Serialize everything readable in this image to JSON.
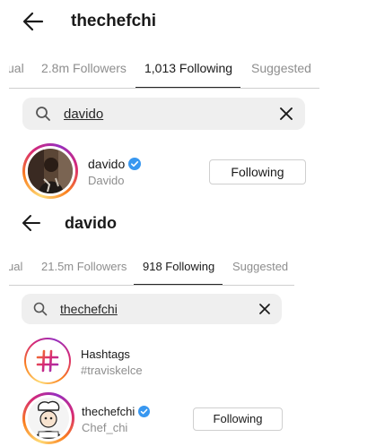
{
  "top": {
    "title": "thechefchi",
    "tabs": [
      {
        "label": "ual"
      },
      {
        "label": "2.8m Followers"
      },
      {
        "label": "1,013 Following"
      },
      {
        "label": "Suggested"
      }
    ],
    "search_value": "davido",
    "result": {
      "username": "davido",
      "display_name": "Davido",
      "button": "Following"
    }
  },
  "bottom": {
    "title": "davido",
    "tabs": [
      {
        "label": "ual"
      },
      {
        "label": "21.5m Followers"
      },
      {
        "label": "918 Following"
      },
      {
        "label": "Suggested"
      }
    ],
    "search_value": "thechefchi",
    "hashtag": {
      "title": "Hashtags",
      "tag": "#traviskelce"
    },
    "result": {
      "username": "thechefchi",
      "display_name": "Chef_chi",
      "button": "Following"
    }
  },
  "icons": [
    "back-arrow-icon",
    "search-icon",
    "close-icon",
    "verified-badge-icon",
    "hashtag-icon"
  ],
  "colors": {
    "verified": "#3897f0",
    "ring_gradient": [
      "#feda75",
      "#fa7e1e",
      "#d62976",
      "#962fbf"
    ]
  }
}
